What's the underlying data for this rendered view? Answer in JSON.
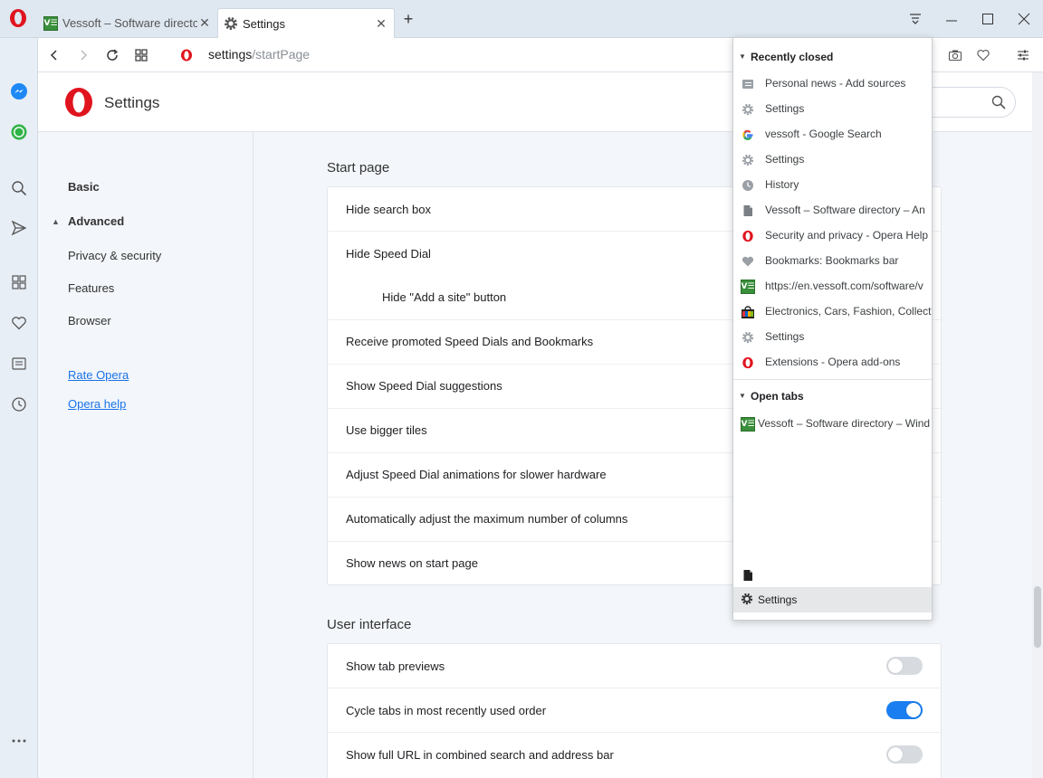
{
  "browser": {
    "tabs": [
      {
        "title": "Vessoft – Software directory",
        "favicon": "ve-icon",
        "active": false
      },
      {
        "title": "Settings",
        "favicon": "gear-icon",
        "active": true
      }
    ],
    "address": {
      "host": "settings",
      "path": "/startPage"
    }
  },
  "settings": {
    "title": "Settings",
    "nav": {
      "basic": "Basic",
      "advanced": "Advanced",
      "privacy": "Privacy & security",
      "features": "Features",
      "browser": "Browser",
      "rate": "Rate Opera",
      "help": "Opera help"
    },
    "start_page": {
      "title": "Start page",
      "rows": [
        "Hide search box",
        "Hide Speed Dial",
        "Hide \"Add a site\" button",
        "Receive promoted Speed Dials and Bookmarks",
        "Show Speed Dial suggestions",
        "Use bigger tiles",
        "Adjust Speed Dial animations for slower hardware",
        "Automatically adjust the maximum number of columns",
        "Show news on start page"
      ]
    },
    "user_interface": {
      "title": "User interface",
      "rows": [
        {
          "label": "Show tab previews",
          "on": false
        },
        {
          "label": "Cycle tabs in most recently used order",
          "on": true
        },
        {
          "label": "Show full URL in combined search and address bar",
          "on": false
        }
      ]
    }
  },
  "tab_menu": {
    "recently_closed_title": "Recently closed",
    "recently_closed": [
      {
        "title": "Personal news - Add sources",
        "icon": "news-icon"
      },
      {
        "title": "Settings",
        "icon": "gear-icon"
      },
      {
        "title": "vessoft - Google Search",
        "icon": "google-icon"
      },
      {
        "title": "Settings",
        "icon": "gear-icon"
      },
      {
        "title": "History",
        "icon": "clock-icon"
      },
      {
        "title": "Vessoft – Software directory – An",
        "icon": "page-icon"
      },
      {
        "title": "Security and privacy - Opera Help",
        "icon": "opera-icon"
      },
      {
        "title": "Bookmarks: Bookmarks bar",
        "icon": "heart-icon"
      },
      {
        "title": "https://en.vessoft.com/software/v",
        "icon": "ve-icon"
      },
      {
        "title": "Electronics, Cars, Fashion, Collect",
        "icon": "ebay-icon"
      },
      {
        "title": "Settings",
        "icon": "gear-icon"
      },
      {
        "title": "Extensions - Opera add-ons",
        "icon": "opera-icon"
      }
    ],
    "open_tabs_title": "Open tabs",
    "open_tabs": [
      {
        "title": "Vessoft – Software directory – Wind",
        "icon": "ve-icon"
      }
    ],
    "bottom_settings": "Settings"
  },
  "colors": {
    "accent": "#1a7ef0",
    "opera_red": "#e0141e",
    "ve_green": "#3a8f3a"
  }
}
